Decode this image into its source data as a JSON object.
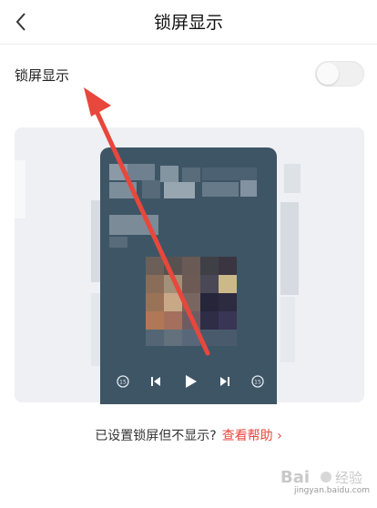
{
  "header": {
    "title": "锁屏显示",
    "back_icon": "chevron-left-icon"
  },
  "settings": {
    "lock_screen_label": "锁屏显示",
    "toggle_state": "off"
  },
  "preview": {
    "player_controls": [
      "rewind-15-icon",
      "previous-icon",
      "play-icon",
      "next-icon",
      "forward-15-icon"
    ]
  },
  "help": {
    "question": "已设置锁屏但不显示?",
    "link": "查看帮助",
    "link_chevron": "›"
  },
  "annotation": {
    "arrow_color": "#e8473b"
  },
  "watermark": {
    "logo_text": "Bai 经验",
    "url": "jingyan.baidu.com"
  }
}
